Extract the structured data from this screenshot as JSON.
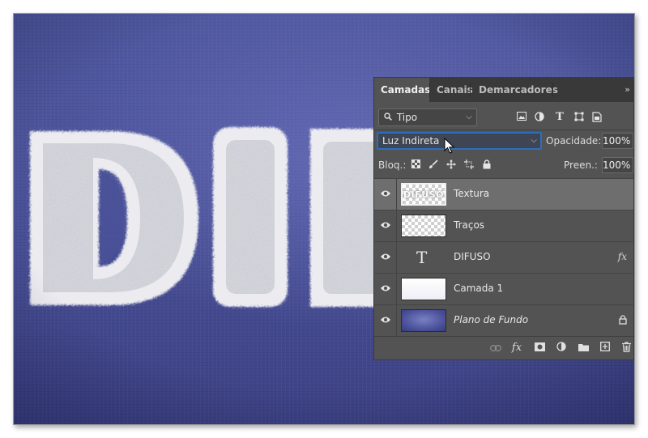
{
  "panel": {
    "tabs": [
      {
        "label": "Camadas"
      },
      {
        "label": "Canais"
      },
      {
        "label": "Demarcadores"
      }
    ],
    "collapse_glyph": "»",
    "filter": {
      "label": "Tipo"
    },
    "blend_mode": "Luz Indireta",
    "opacity_label": "Opacidade:",
    "opacity_value": "100%",
    "lock_label": "Bloq.:",
    "fill_label": "Preen.:",
    "fill_value": "100%",
    "layers": [
      {
        "name": "Textura",
        "thumb_text": "DIFUSO",
        "selected": true
      },
      {
        "name": "Traços"
      },
      {
        "name": "DIFUSO",
        "type": "text",
        "fx": "fx"
      },
      {
        "name": "Camada 1"
      },
      {
        "name": "Plano de Fundo",
        "locked": true
      }
    ]
  },
  "canvas": {
    "artwork_text": "DIF",
    "background_color": "#4a5198",
    "fur_color": "#f2f2f4"
  }
}
